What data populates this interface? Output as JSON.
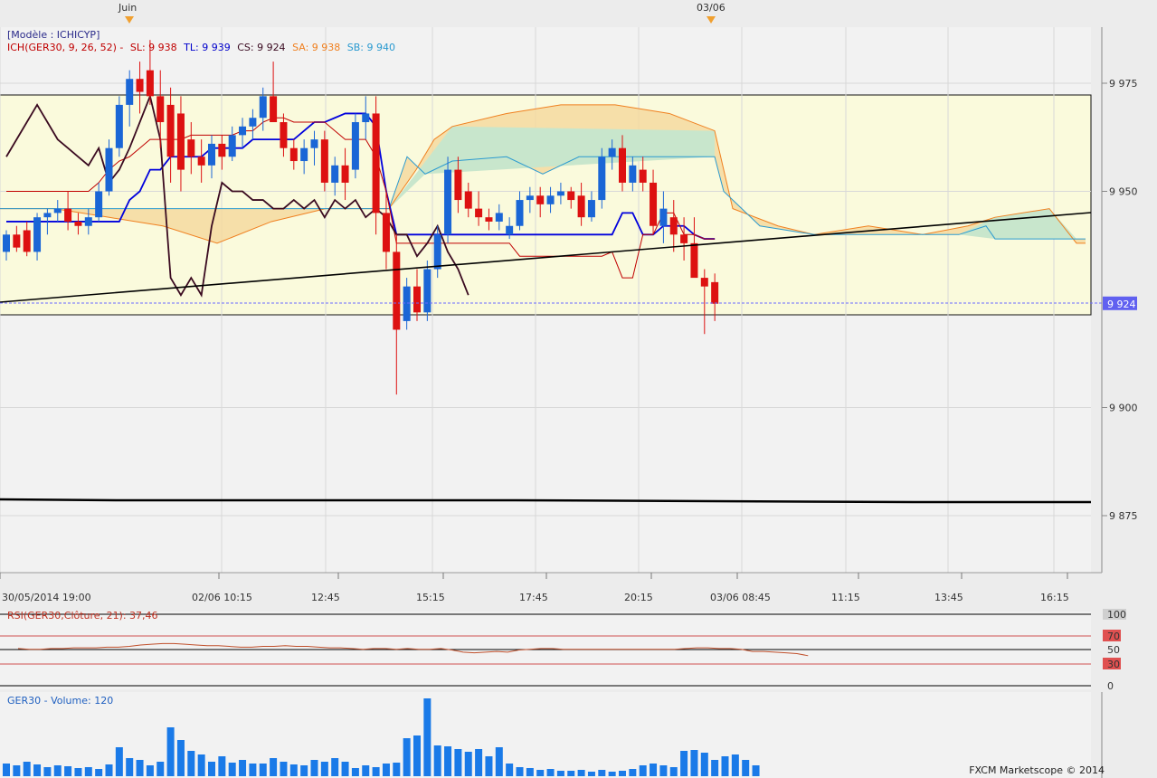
{
  "top_markers": [
    "Juin",
    "03/06"
  ],
  "header": {
    "model": "[Modèle : ICHICYP]",
    "ich_prefix": "ICH(GER30, 9, 26, 52) -",
    "sl": "SL: 9 938",
    "tl": "TL: 9 939",
    "cs": "CS: 9 924",
    "sa": "SA: 9 938",
    "sb": "SB: 9 940"
  },
  "price_axis": {
    "ticks": [
      {
        "v": 9975,
        "label": "9 975"
      },
      {
        "v": 9950,
        "label": "9 950"
      },
      {
        "v": 9900,
        "label": "9 900"
      },
      {
        "v": 9875,
        "label": "9 875"
      }
    ],
    "current": {
      "v": 9924,
      "label": "9 924"
    },
    "range": [
      9860,
      9990
    ]
  },
  "time_axis": [
    "30/05/2014 19:00",
    "02/06 10:15",
    "12:45",
    "15:15",
    "17:45",
    "20:15",
    "03/06 08:45",
    "11:15",
    "13:45",
    "16:15"
  ],
  "rsi": {
    "label": "RSI(GER30,Clôture, 21): 37,46",
    "ticks": [
      "100",
      "70",
      "50",
      "30",
      "0"
    ],
    "values": [
      52,
      51,
      51,
      52,
      52,
      53,
      53,
      53,
      54,
      54,
      55,
      57,
      58,
      59,
      59,
      58,
      57,
      56,
      56,
      55,
      54,
      54,
      55,
      55,
      56,
      55,
      55,
      54,
      53,
      53,
      52,
      51,
      52,
      52,
      51,
      52,
      51,
      51,
      52,
      50,
      47,
      46,
      47,
      48,
      47,
      50,
      51,
      52,
      52,
      51,
      51,
      51,
      51,
      51,
      51,
      51,
      51,
      51,
      51,
      51,
      52,
      53,
      53,
      52,
      52,
      51,
      48,
      48,
      47,
      46,
      45,
      42
    ]
  },
  "volume": {
    "label": "GER30 - Volume: 120",
    "values": [
      14,
      12,
      16,
      13,
      10,
      12,
      11,
      9,
      10,
      8,
      13,
      32,
      20,
      18,
      12,
      16,
      54,
      40,
      28,
      24,
      16,
      22,
      15,
      18,
      14,
      14,
      20,
      16,
      13,
      12,
      18,
      16,
      20,
      16,
      9,
      12,
      10,
      14,
      15,
      42,
      45,
      86,
      34,
      33,
      30,
      27,
      30,
      22,
      32,
      14,
      10,
      9,
      7,
      8,
      6,
      6,
      7,
      5,
      7,
      5,
      6,
      8,
      12,
      14,
      12,
      10,
      28,
      29,
      26,
      18,
      22,
      24,
      18,
      12
    ]
  },
  "chart_data": {
    "type": "candlestick",
    "title": "GER30",
    "indicator": "Ichimoku Kinko Hyo (9, 26, 52)",
    "ylim": [
      9860,
      9990
    ],
    "candles_ohlc": [
      [
        9936,
        9941,
        9934,
        9940
      ],
      [
        9940,
        9942,
        9936,
        9937
      ],
      [
        9941,
        9943,
        9935,
        9936
      ],
      [
        9936,
        9945,
        9934,
        9944
      ],
      [
        9944,
        9946,
        9940,
        9945
      ],
      [
        9945,
        9948,
        9943,
        9946
      ],
      [
        9946,
        9950,
        9941,
        9943
      ],
      [
        9943,
        9945,
        9940,
        9942
      ],
      [
        9942,
        9946,
        9940,
        9944
      ],
      [
        9944,
        9952,
        9943,
        9950
      ],
      [
        9950,
        9962,
        9949,
        9960
      ],
      [
        9960,
        9972,
        9958,
        9970
      ],
      [
        9970,
        9978,
        9965,
        9976
      ],
      [
        9976,
        9980,
        9968,
        9973
      ],
      [
        9978,
        9985,
        9970,
        9972
      ],
      [
        9972,
        9978,
        9960,
        9966
      ],
      [
        9970,
        9974,
        9952,
        9958
      ],
      [
        9968,
        9972,
        9950,
        9955
      ],
      [
        9962,
        9966,
        9954,
        9958
      ],
      [
        9958,
        9962,
        9952,
        9956
      ],
      [
        9956,
        9963,
        9953,
        9961
      ],
      [
        9961,
        9963,
        9955,
        9958
      ],
      [
        9958,
        9965,
        9957,
        9963
      ],
      [
        9963,
        9967,
        9960,
        9965
      ],
      [
        9965,
        9969,
        9962,
        9967
      ],
      [
        9967,
        9974,
        9964,
        9972
      ],
      [
        9972,
        9980,
        9968,
        9966
      ],
      [
        9966,
        9968,
        9958,
        9960
      ],
      [
        9960,
        9962,
        9955,
        9957
      ],
      [
        9957,
        9962,
        9954,
        9960
      ],
      [
        9960,
        9964,
        9956,
        9962
      ],
      [
        9962,
        9964,
        9950,
        9952
      ],
      [
        9952,
        9958,
        9949,
        9956
      ],
      [
        9956,
        9960,
        9948,
        9952
      ],
      [
        9955,
        9968,
        9953,
        9966
      ],
      [
        9966,
        9972,
        9962,
        9968
      ],
      [
        9968,
        9972,
        9940,
        9945
      ],
      [
        9945,
        9950,
        9932,
        9936
      ],
      [
        9936,
        9940,
        9903,
        9918
      ],
      [
        9920,
        9930,
        9918,
        9928
      ],
      [
        9928,
        9932,
        9920,
        9922
      ],
      [
        9922,
        9934,
        9920,
        9932
      ],
      [
        9932,
        9942,
        9930,
        9940
      ],
      [
        9940,
        9958,
        9938,
        9955
      ],
      [
        9955,
        9958,
        9945,
        9948
      ],
      [
        9950,
        9952,
        9944,
        9946
      ],
      [
        9946,
        9950,
        9942,
        9944
      ],
      [
        9944,
        9946,
        9941,
        9943
      ],
      [
        9943,
        9947,
        9941,
        9945
      ],
      [
        9940,
        9944,
        9939,
        9942
      ],
      [
        9942,
        9950,
        9941,
        9948
      ],
      [
        9948,
        9951,
        9945,
        9949
      ],
      [
        9949,
        9951,
        9944,
        9947
      ],
      [
        9947,
        9951,
        9945,
        9949
      ],
      [
        9949,
        9952,
        9947,
        9950
      ],
      [
        9950,
        9951,
        9946,
        9948
      ],
      [
        9949,
        9952,
        9942,
        9944
      ],
      [
        9944,
        9950,
        9943,
        9948
      ],
      [
        9948,
        9960,
        9946,
        9958
      ],
      [
        9958,
        9962,
        9955,
        9960
      ],
      [
        9960,
        9963,
        9950,
        9952
      ],
      [
        9952,
        9958,
        9950,
        9956
      ],
      [
        9955,
        9958,
        9950,
        9952
      ],
      [
        9952,
        9955,
        9940,
        9942
      ],
      [
        9942,
        9950,
        9938,
        9946
      ],
      [
        9944,
        9948,
        9936,
        9940
      ],
      [
        9940,
        9944,
        9934,
        9938
      ],
      [
        9938,
        9944,
        9932,
        9930
      ],
      [
        9930,
        9932,
        9917,
        9928
      ],
      [
        9929,
        9931,
        9920,
        9924
      ]
    ],
    "tenkan_sen": [
      9950,
      9950,
      9950,
      9950,
      9950,
      9950,
      9950,
      9950,
      9950,
      9952,
      9955,
      9957,
      9958,
      9960,
      9962,
      9962,
      9962,
      9962,
      9963,
      9963,
      9963,
      9963,
      9963,
      9964,
      9964,
      9966,
      9967,
      9967,
      9966,
      9966,
      9966,
      9966,
      9964,
      9962,
      9962,
      9962,
      9958,
      9950,
      9938,
      9938,
      9938,
      9938,
      9938,
      9938,
      9938,
      9938,
      9938,
      9938,
      9938,
      9938,
      9935,
      9935,
      9935,
      9935,
      9935,
      9935,
      9935,
      9935,
      9935,
      9936,
      9930,
      9930,
      9940,
      9940,
      9945,
      9945,
      9940,
      9940,
      9939,
      9939
    ],
    "kijun_sen": [
      9943,
      9943,
      9943,
      9943,
      9943,
      9943,
      9943,
      9943,
      9943,
      9943,
      9943,
      9943,
      9948,
      9950,
      9955,
      9955,
      9958,
      9958,
      9958,
      9958,
      9960,
      9960,
      9960,
      9960,
      9962,
      9962,
      9962,
      9962,
      9962,
      9964,
      9966,
      9966,
      9967,
      9968,
      9968,
      9968,
      9965,
      9950,
      9940,
      9940,
      9940,
      9940,
      9940,
      9940,
      9940,
      9940,
      9940,
      9940,
      9940,
      9940,
      9940,
      9940,
      9940,
      9940,
      9940,
      9940,
      9940,
      9940,
      9940,
      9940,
      9945,
      9945,
      9940,
      9940,
      9942,
      9942,
      9942,
      9940,
      9939,
      9939
    ],
    "chikou_span": [
      9958,
      9962,
      9966,
      9970,
      9966,
      9962,
      9960,
      9958,
      9956,
      9960,
      9952,
      9955,
      9960,
      9966,
      9972,
      9962,
      9930,
      9926,
      9930,
      9926,
      9942,
      9952,
      9950,
      9950,
      9948,
      9948,
      9946,
      9946,
      9948,
      9946,
      9948,
      9944,
      9948,
      9946,
      9948,
      9944,
      9946,
      9944,
      9940,
      9940,
      9935,
      9938,
      9942,
      9936,
      9932,
      9926
    ]
  }
}
